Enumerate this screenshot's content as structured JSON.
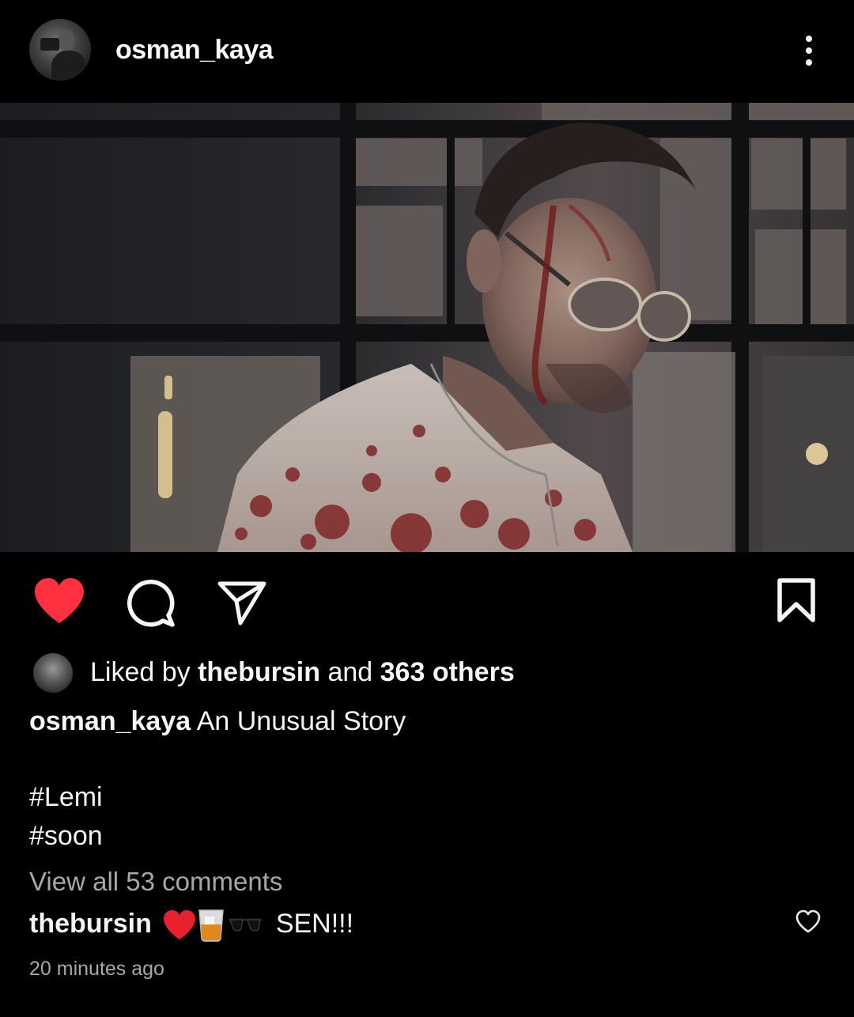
{
  "post": {
    "username": "osman_kaya",
    "likes": {
      "prefix": "Liked by",
      "user": "thebursin",
      "and": "and",
      "count_text": "363 others"
    },
    "caption": {
      "username": "osman_kaya",
      "text": "An Unusual Story",
      "tags": [
        "#Lemi",
        "#soon"
      ]
    },
    "view_all_comments": "View all 53 comments",
    "top_comment": {
      "username": "thebursin",
      "emoji_names": [
        "red-heart",
        "whisky-glass",
        "sunglasses"
      ],
      "text": "SEN!!!"
    },
    "timestamp": "20 minutes ago",
    "liked": true
  },
  "colors": {
    "background": "#000000",
    "text": "#f5f5f5",
    "secondary_text": "#a8a8a8",
    "like_red": "#ff3040"
  },
  "icons": {
    "more": "more-vertical-icon",
    "like": "heart-icon",
    "comment": "comment-icon",
    "share": "paper-plane-icon",
    "save": "bookmark-icon",
    "comment_like": "small-heart-icon"
  }
}
